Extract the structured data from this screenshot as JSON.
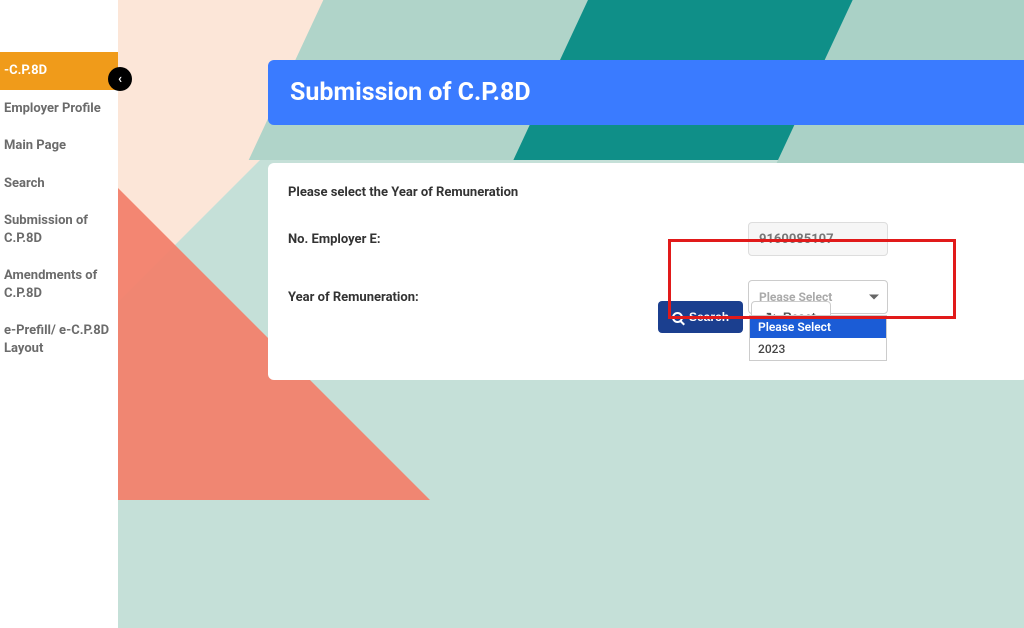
{
  "sidebar": {
    "items": [
      {
        "label": "-C.P.8D",
        "active": true
      },
      {
        "label": "Employer Profile"
      },
      {
        "label": "Main Page"
      },
      {
        "label": "Search"
      },
      {
        "label": "Submission of C.P.8D"
      },
      {
        "label": "Amendments of C.P.8D"
      },
      {
        "label": "e-Prefill/ e-C.P.8D Layout"
      }
    ]
  },
  "page": {
    "title": "Submission of C.P.8D",
    "instruction": "Please select the Year of Remuneration",
    "form": {
      "employer_label": "No. Employer E:",
      "employer_value": "9160085107",
      "year_label": "Year of Remuneration:",
      "year_placeholder": "Please Select",
      "year_options": [
        "Please Select",
        "2023"
      ]
    },
    "actions": {
      "search": "Search",
      "reset": "Reset"
    }
  }
}
